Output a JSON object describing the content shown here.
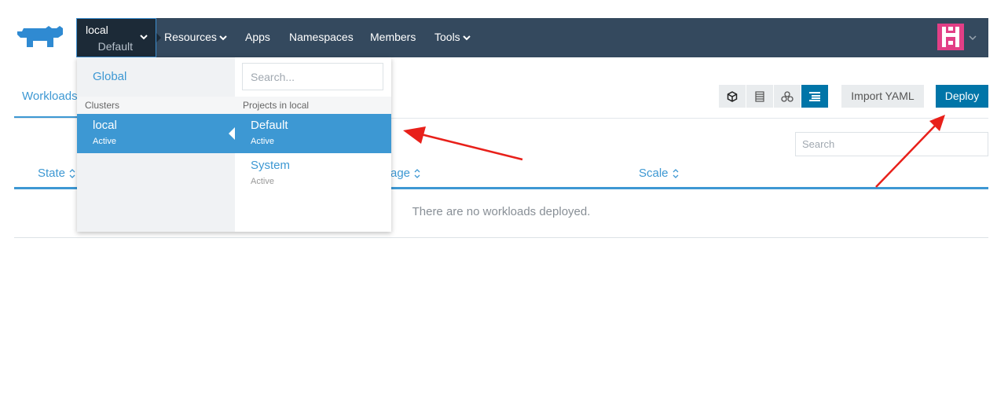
{
  "colors": {
    "navbar": "#34495e",
    "cluster_switch": "#1c2a37",
    "accent": "#3d98d3",
    "primary_button": "#0075a8",
    "annotation": "#e8201a"
  },
  "logo": {
    "icon": "rancher-cow-logo"
  },
  "nav": {
    "cluster_name": "local",
    "project_name": "Default",
    "resources": "Resources",
    "apps": "Apps",
    "namespaces": "Namespaces",
    "members": "Members",
    "tools": "Tools",
    "avatar_icon": "user-avatar-icon"
  },
  "page": {
    "tab_label": "Workloads",
    "import_button": "Import YAML",
    "deploy_button": "Deploy",
    "search_placeholder": "Search",
    "view_buttons": [
      "cube-icon",
      "list-rows-icon",
      "nodes-icon",
      "grouped-list-icon"
    ],
    "active_view": 3
  },
  "table": {
    "columns": [
      "State",
      "Image",
      "Scale"
    ],
    "visible_headers": {
      "state": "State",
      "image": "age",
      "scale": "Scale"
    },
    "empty_message": "There are no workloads deployed."
  },
  "dropdown": {
    "global_label": "Global",
    "clusters_header": "Clusters",
    "projects_header": "Projects in local",
    "search_placeholder": "Search...",
    "clusters": [
      {
        "name": "local",
        "status": "Active",
        "selected": true
      }
    ],
    "projects": [
      {
        "name": "Default",
        "status": "Active",
        "selected": true
      },
      {
        "name": "System",
        "status": "Active",
        "selected": false
      }
    ]
  }
}
